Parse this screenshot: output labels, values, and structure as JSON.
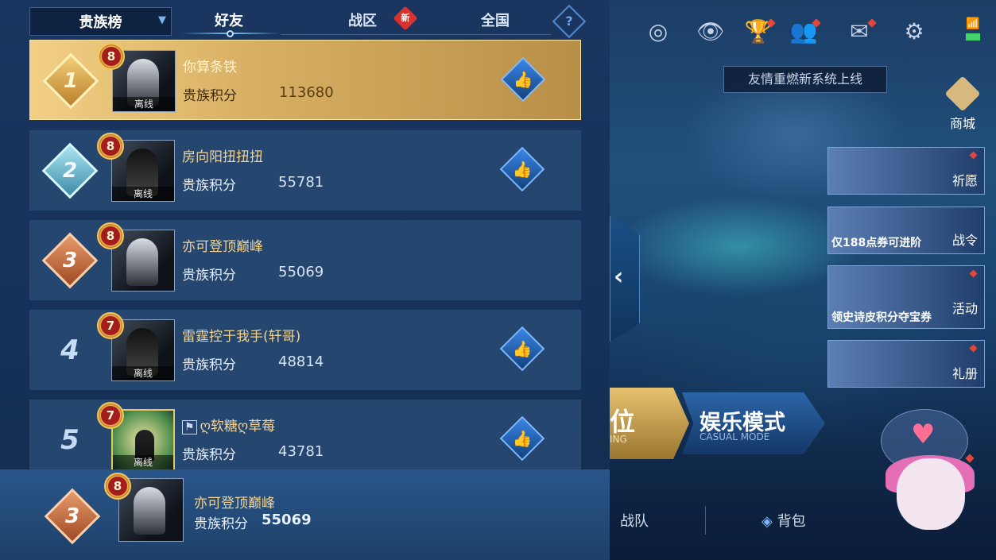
{
  "header": {
    "dropdown_label": "贵族榜",
    "tabs": [
      {
        "label": "好友"
      },
      {
        "label": "战区"
      },
      {
        "label": "全国"
      }
    ],
    "new_badge": "新",
    "help": "?"
  },
  "leaderboard": {
    "score_label": "贵族积分",
    "offline_label": "离线",
    "rows": [
      {
        "rank": "1",
        "level": "8",
        "name": "你算条铁",
        "score": "113680"
      },
      {
        "rank": "2",
        "level": "8",
        "name": "房向阳扭扭扭",
        "score": "55781"
      },
      {
        "rank": "3",
        "level": "8",
        "name": "亦可登顶巅峰",
        "score": "55069"
      },
      {
        "rank": "4",
        "level": "7",
        "name": "雷霆控于我手(轩哥)",
        "score": "48814"
      },
      {
        "rank": "5",
        "level": "7",
        "name": "ღ软糖ღ草莓",
        "score": "43781"
      }
    ],
    "self": {
      "rank": "3",
      "level": "8",
      "name": "亦可登顶巅峰",
      "score_label": "贵族积分",
      "score": "55069"
    }
  },
  "lobby": {
    "notice": "友情重燃新系统上线",
    "shop_label": "商城",
    "cards": [
      {
        "label": "祈愿",
        "sub": ""
      },
      {
        "label": "战令",
        "sub": "仅188点券可进阶"
      },
      {
        "label": "活动",
        "sub": "领史诗皮积分夺宝券"
      },
      {
        "label": "礼册",
        "sub": ""
      }
    ],
    "mode_left": {
      "label": "位",
      "sub": "ING"
    },
    "mode_right": {
      "label": "娱乐模式",
      "sub": "CASUAL MODE"
    },
    "bottom_nav": [
      {
        "label": "战队"
      },
      {
        "label": "背包"
      }
    ]
  },
  "icons": [
    "chevron-down-icon",
    "help-icon",
    "like-icon",
    "target-icon",
    "eye-icon",
    "trophy-icon",
    "friends-icon",
    "mail-icon",
    "gear-icon",
    "wifi-icon",
    "battery-icon",
    "collapse-arrow-icon",
    "shop-icon",
    "backpack-icon"
  ],
  "colors": {
    "gold_row": "#d8b064",
    "panel": "#1a3660",
    "row": "#25466f",
    "name_gold": "#f4d490",
    "red_dot": "#e3463b"
  }
}
